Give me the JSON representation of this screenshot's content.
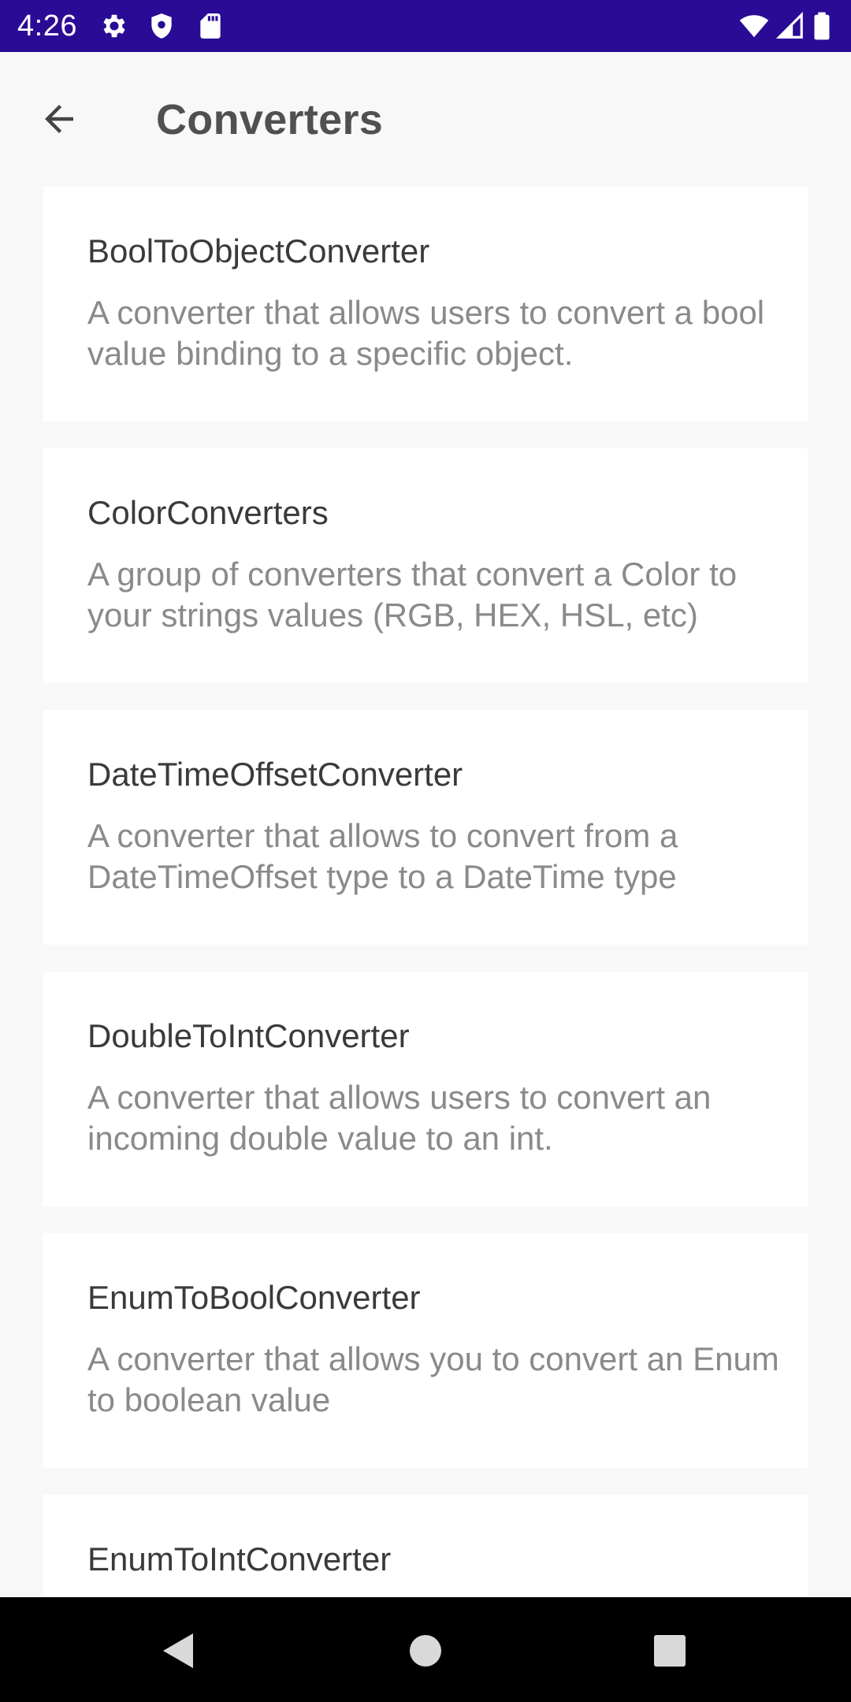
{
  "status_bar": {
    "time": "4:26",
    "icons": [
      "gear-icon",
      "shield-icon",
      "sd-card-icon",
      "wifi-icon",
      "cell-signal-icon",
      "battery-icon"
    ],
    "background": "#2a0b95"
  },
  "app_bar": {
    "title": "Converters",
    "back_icon": "arrow-left-icon"
  },
  "converters": [
    {
      "title": "BoolToObjectConverter",
      "description": "A converter that allows users to convert a bool value binding to a specific object."
    },
    {
      "title": "ColorConverters",
      "description": "A group of converters that convert a Color to your strings values (RGB, HEX, HSL, etc)"
    },
    {
      "title": "DateTimeOffsetConverter",
      "description": "A converter that allows to convert from a DateTimeOffset type to a DateTime type"
    },
    {
      "title": "DoubleToIntConverter",
      "description": "A converter that allows users to convert an incoming double value to an int."
    },
    {
      "title": "EnumToBoolConverter",
      "description": "A converter that allows you to convert an Enum to boolean value"
    },
    {
      "title": "EnumToIntConverter",
      "description": ""
    }
  ],
  "nav_bar": {
    "icons": [
      "back-triangle-icon",
      "home-circle-icon",
      "recents-square-icon"
    ]
  },
  "colors": {
    "status_bar": "#2a0b95",
    "background": "#f8f8f8",
    "card": "#ffffff",
    "title_text": "#3a3a3a",
    "desc_text": "#8a8a8a"
  }
}
